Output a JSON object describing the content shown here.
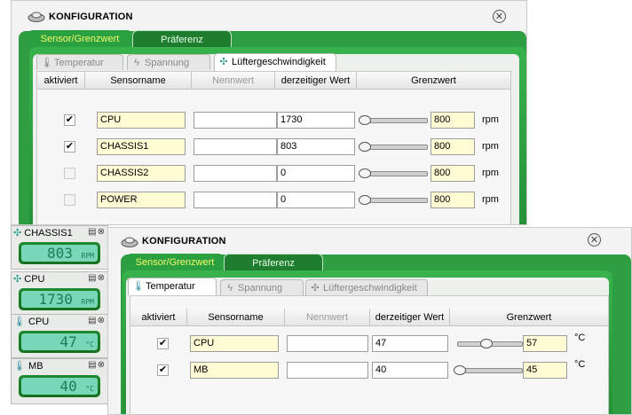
{
  "colors": {
    "accent_green": "#2f9e43",
    "active_tab_text": "#f3f86a",
    "field_yellow": "#fffbd5"
  },
  "window1": {
    "title": "KONFIGURATION",
    "close_icon": "close-icon",
    "tabs": [
      "Sensor/Grenzwert",
      "Präferenz"
    ],
    "subtabs": [
      "Temperatur",
      "Spannung",
      "Lüftergeschwindigkeit"
    ],
    "columns": [
      "aktiviert",
      "Sensorname",
      "Nennwert",
      "derzeitiger Wert",
      "Grenzwert"
    ],
    "rows": [
      {
        "checked": true,
        "name": "CPU",
        "nominal": "",
        "current": "1730",
        "limit": "800",
        "unit": "rpm",
        "slider": 0.0
      },
      {
        "checked": true,
        "name": "CHASSIS1",
        "nominal": "",
        "current": "803",
        "limit": "800",
        "unit": "rpm",
        "slider": 0.0
      },
      {
        "checked": false,
        "name": "CHASSIS2",
        "nominal": "",
        "current": "0",
        "limit": "800",
        "unit": "rpm",
        "slider": 0.0
      },
      {
        "checked": false,
        "name": "POWER",
        "nominal": "",
        "current": "0",
        "limit": "800",
        "unit": "rpm",
        "slider": 0.0
      }
    ]
  },
  "window2": {
    "title": "KONFIGURATION",
    "tabs": [
      "Sensor/Grenzwert",
      "Präferenz"
    ],
    "subtabs": [
      "Temperatur",
      "Spannung",
      "Lüftergeschwindigkeit"
    ],
    "columns": [
      "aktiviert",
      "Sensorname",
      "Nennwert",
      "derzeitiger Wert",
      "Grenzwert"
    ],
    "rows": [
      {
        "checked": true,
        "name": "CPU",
        "nominal": "",
        "current": "47",
        "limit": "57",
        "unit": "°C",
        "slider": 0.45
      },
      {
        "checked": true,
        "name": "MB",
        "nominal": "",
        "current": "40",
        "limit": "45",
        "unit": "°C",
        "slider": 0.0
      }
    ]
  },
  "widgets": [
    {
      "icon": "fan-icon",
      "label": "CHASSIS1",
      "value": "803",
      "unit": "RPM"
    },
    {
      "icon": "fan-icon",
      "label": "CPU",
      "value": "1730",
      "unit": "RPM"
    },
    {
      "icon": "thermometer-icon",
      "label": "CPU",
      "value": "47",
      "unit": "°C"
    },
    {
      "icon": "thermometer-icon",
      "label": "MB",
      "value": "40",
      "unit": "°C"
    }
  ]
}
